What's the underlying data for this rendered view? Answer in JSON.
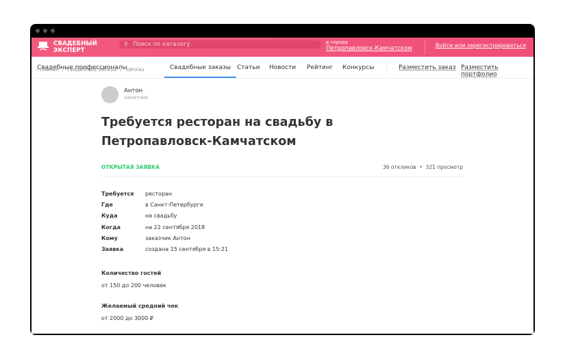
{
  "header": {
    "brand": [
      "СВАДЕБНЫЙ",
      "ЭКСПЕРТ"
    ],
    "search_placeholder": "Поиск по каталогу",
    "city_label": "в городе",
    "city": "Петропавловск-Камчатском",
    "login": "Войти или зарегистрироваться",
    "accent": "#f25a7c"
  },
  "nav": {
    "dropdown": "Свадебные профессионалы",
    "items": [
      "Свадебные заказы",
      "Статьи",
      "Новости",
      "Рейтинг",
      "Конкурсы"
    ],
    "active": "Свадебные заказы",
    "actions": [
      "Разместить заказ",
      "Разместить портфолио"
    ]
  },
  "breadcrumb": [
    "главная",
    "свадебные заказы",
    "заказы"
  ],
  "order": {
    "user": "Антон",
    "role": "заказчик",
    "title": "Требуется ресторан на свадьбу в Петропавловск-Камчатском",
    "status": "ОТКРЫТАЯ ЗАЯВКА",
    "responses": "36 откликов",
    "views": "321 просмотр",
    "details": [
      {
        "k": "Требуется",
        "v": "ресторан"
      },
      {
        "k": "Где",
        "v": "в Санкт-Петербурге"
      },
      {
        "k": "Куда",
        "v": "на свадьбу"
      },
      {
        "k": "Когда",
        "v": "на 22 сентября 2018"
      },
      {
        "k": "Кому",
        "v": "заказчик Антон"
      },
      {
        "k": "Заявка",
        "v": "создана 15 сентября в 15:21"
      }
    ],
    "guests_label": "Количество гостей",
    "guests": "от 150 до 200 человек",
    "budget_label": "Желаемый средний чек",
    "budget": "от 2000 до 3000 ₽"
  }
}
